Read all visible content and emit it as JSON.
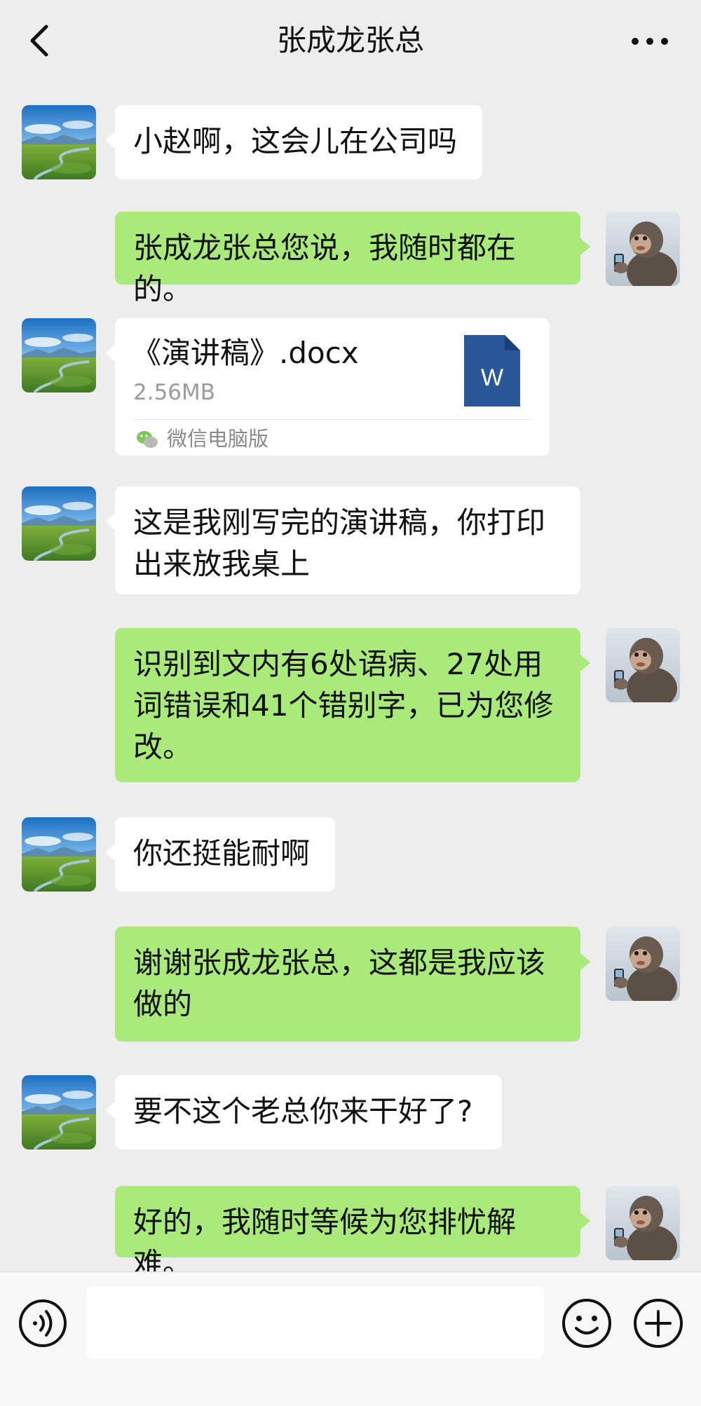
{
  "header": {
    "title": "张成龙张总",
    "back_icon": "chevron-left-icon",
    "more_icon": "more-dots-icon"
  },
  "colors": {
    "background": "#ededed",
    "outgoing_bubble": "#a9ea7a",
    "incoming_bubble": "#ffffff",
    "word_icon": "#2b579a"
  },
  "messages": [
    {
      "side": "in",
      "text": "小赵啊，这会儿在公司吗"
    },
    {
      "side": "out",
      "text": "张成龙张总您说，我随时都在的。"
    },
    {
      "side": "in",
      "type": "file",
      "file": {
        "name": "《演讲稿》.docx",
        "size": "2.56MB",
        "source": "微信电脑版",
        "icon_letter": "W"
      }
    },
    {
      "side": "in",
      "text": "这是我刚写完的演讲稿，你打印出来放我桌上"
    },
    {
      "side": "out",
      "text": "识别到文内有6处语病、27处用词错误和41个错别字，已为您修改。"
    },
    {
      "side": "in",
      "text": "你还挺能耐啊"
    },
    {
      "side": "out",
      "text": "谢谢张成龙张总，这都是我应该做的"
    },
    {
      "side": "in",
      "text": "要不这个老总你来干好了?"
    },
    {
      "side": "out",
      "text": "好的，我随时等候为您排忧解难。"
    }
  ],
  "input_bar": {
    "placeholder": "",
    "voice_icon": "voice-icon",
    "emoji_icon": "emoji-icon",
    "plus_icon": "plus-icon"
  }
}
